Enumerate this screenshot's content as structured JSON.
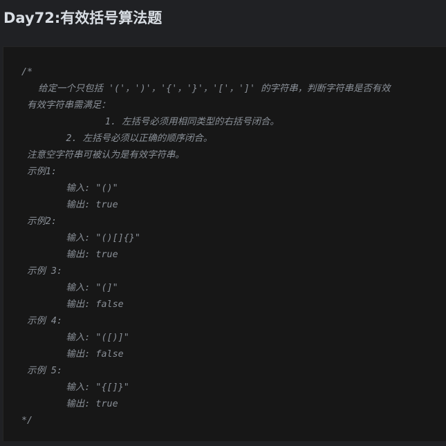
{
  "page": {
    "title": "Day72:有效括号算法题"
  },
  "code": {
    "lines": [
      "/*",
      "   给定一个只包括 '('，')'，'{'，'}'，'['，']' 的字符串，判断字符串是否有效",
      " 有效字符串需满足：",
      "               1. 左括号必须用相同类型的右括号闭合。",
      "        2. 左括号必须以正确的顺序闭合。",
      " 注意空字符串可被认为是有效字符串。",
      " 示例1:",
      "        输入: \"()\"",
      "        输出: true",
      " 示例2:",
      "        输入: \"()[]{}\"",
      "        输出: true",
      " 示例 3:",
      "        输入: \"(]\"",
      "        输出: false",
      " 示例 4:",
      "        输入: \"([)]\"",
      "        输出: false",
      " 示例 5:",
      "        输入: \"{[]}\"",
      "        输出: true",
      "*/"
    ]
  },
  "colors": {
    "page_background": "#202124",
    "code_background": "#171717",
    "title_text": "#d8dde3",
    "comment_text": "#8a9098"
  }
}
